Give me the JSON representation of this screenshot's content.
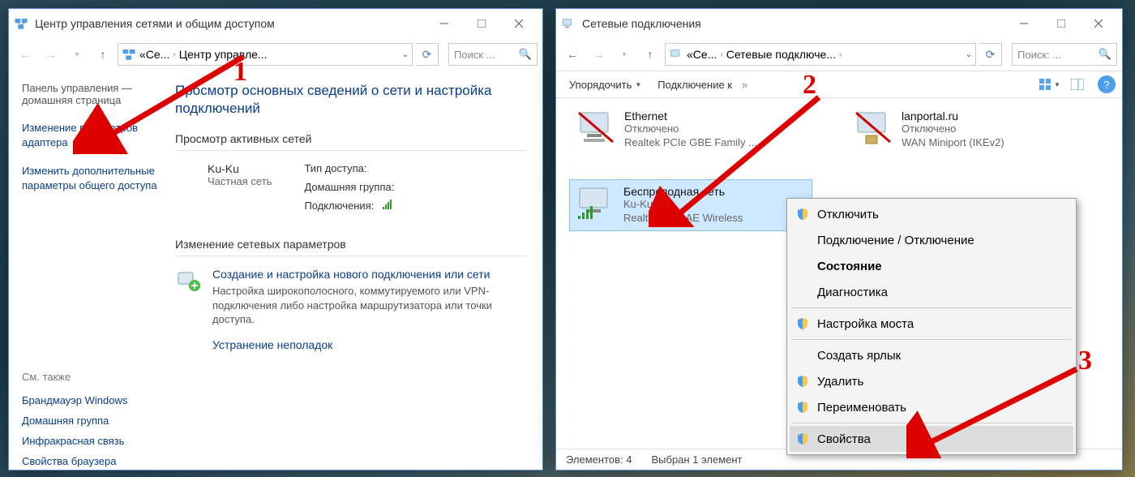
{
  "win1": {
    "title": "Центр управления сетями и общим доступом",
    "crumb_a": "Се...",
    "crumb_b": "Центр управле...",
    "search_ph": "Поиск ...",
    "side_intro": "Панель управления — домашняя страница",
    "side_link1": "Изменение параметров адаптера",
    "side_link2": "Изменить дополнительные параметры общего доступа",
    "seealso_h": "См. также",
    "seealso": [
      "Брандмауэр Windows",
      "Домашняя группа",
      "Инфракрасная связь",
      "Свойства браузера"
    ],
    "h1": "Просмотр основных сведений о сети и настройка подключений",
    "sect_active": "Просмотр активных сетей",
    "net_name": "Ku-Ku",
    "net_type": "Частная сеть",
    "lbl_access": "Тип доступа:",
    "lbl_home": "Домашняя группа:",
    "lbl_conn": "Подключения:",
    "sect_change": "Изменение сетевых параметров",
    "ch_title": "Создание и настройка нового подключения или сети",
    "ch_desc": "Настройка широкополосного, коммутируемого или VPN-подключения либо настройка маршрутизатора или точки доступа.",
    "trouble": "Устранение неполадок"
  },
  "win2": {
    "title": "Сетевые подключения",
    "crumb_a": "Се...",
    "crumb_b": "Сетевые подключе...",
    "search_ph": "Поиск: ...",
    "cmd_org": "Упорядочить",
    "cmd_conn": "Подключение к",
    "adapters": [
      {
        "name": "Ethernet",
        "l1": "Отключено",
        "l2": "Realtek PCIe GBE Family ..."
      },
      {
        "name": "lanportal.ru",
        "l1": "Отключено",
        "l2": "WAN Miniport (IKEv2)"
      },
      {
        "name": "Беспроводная сеть",
        "l1": "Ku-Ku",
        "l2": "Realtek 8821AE Wireless"
      }
    ],
    "status_count": "Элементов: 4",
    "status_sel": "Выбран 1 элемент"
  },
  "ctx": {
    "items": [
      {
        "label": "Отключить",
        "shield": true
      },
      {
        "label": "Подключение / Отключение",
        "shield": false
      },
      {
        "label": "Состояние",
        "shield": false,
        "bold": true
      },
      {
        "label": "Диагностика",
        "shield": false
      },
      {
        "sep": true
      },
      {
        "label": "Настройка моста",
        "shield": true
      },
      {
        "sep": true
      },
      {
        "label": "Создать ярлык",
        "shield": false
      },
      {
        "label": "Удалить",
        "shield": true
      },
      {
        "label": "Переименовать",
        "shield": true
      },
      {
        "sep": true
      },
      {
        "label": "Свойства",
        "shield": true,
        "hover": true
      }
    ]
  },
  "anno": {
    "n1": "1",
    "n2": "2",
    "n3": "3"
  }
}
